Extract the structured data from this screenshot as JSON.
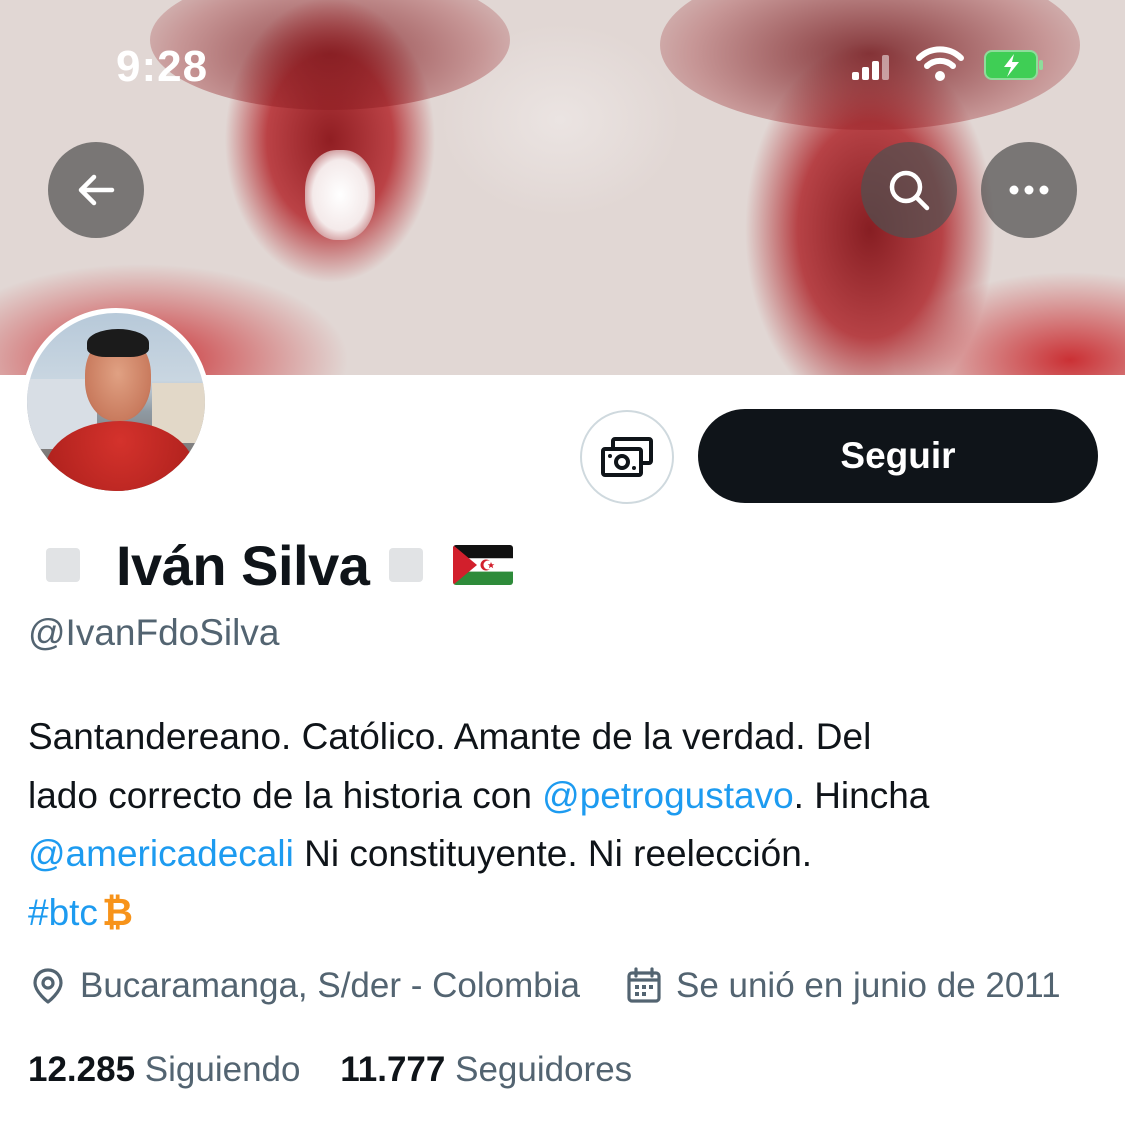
{
  "status_bar": {
    "time": "9:28"
  },
  "profile": {
    "display_name": "Iván Silva",
    "handle": "@IvanFdoSilva",
    "follow_label": "Seguir",
    "bio": {
      "line1": "Santandereano. Católico. Amante de la verdad. Del",
      "line2_pre": "lado correcto de la historia con ",
      "line2_link": "@petrogustavo",
      "line2_post": ". Hincha",
      "line3_link": "@americadecali",
      "line3_post": " Ni constituyente. Ni reelección.",
      "line4_hashtag": "#btc",
      "line4_symbol": "₿"
    },
    "location": "Bucaramanga, S/der - Colombia",
    "joined": "Se unió en junio de 2011",
    "following_count": "12.285",
    "following_label": "Siguiendo",
    "followers_count": "11.777",
    "followers_label": "Seguidores"
  },
  "icons": {
    "back": "arrow-left-icon",
    "search": "search-icon",
    "more": "more-icon",
    "tip": "tip-money-icon",
    "location": "location-pin-icon",
    "calendar": "calendar-icon",
    "flag": "sahrawi-flag-icon"
  },
  "colors": {
    "link": "#1d9bf0",
    "follow_button_bg": "#0f1419",
    "secondary_text": "#536471",
    "bitcoin": "#f7931a"
  }
}
